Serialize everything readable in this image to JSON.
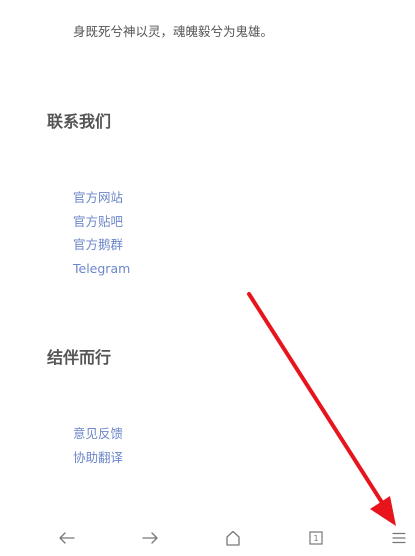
{
  "poem": {
    "line": "身既死兮神以灵，魂魄毅兮为鬼雄。"
  },
  "contact": {
    "heading": "联系我们",
    "links": [
      "官方网站",
      "官方贴吧",
      "官方鹅群",
      "Telegram"
    ]
  },
  "together": {
    "heading": "结伴而行",
    "links": [
      "意见反馈",
      "协助翻译"
    ]
  },
  "bottom_nav": {
    "back_icon": "arrow-left-icon",
    "forward_icon": "arrow-right-icon",
    "home_icon": "home-icon",
    "tabs_icon": "tabs-icon",
    "tabs_count": "1",
    "menu_icon": "hamburger-menu-icon"
  },
  "colors": {
    "link": "#6c86c9",
    "heading": "#555555",
    "annotation_arrow": "#e8141c",
    "nav_icon": "#777777"
  }
}
